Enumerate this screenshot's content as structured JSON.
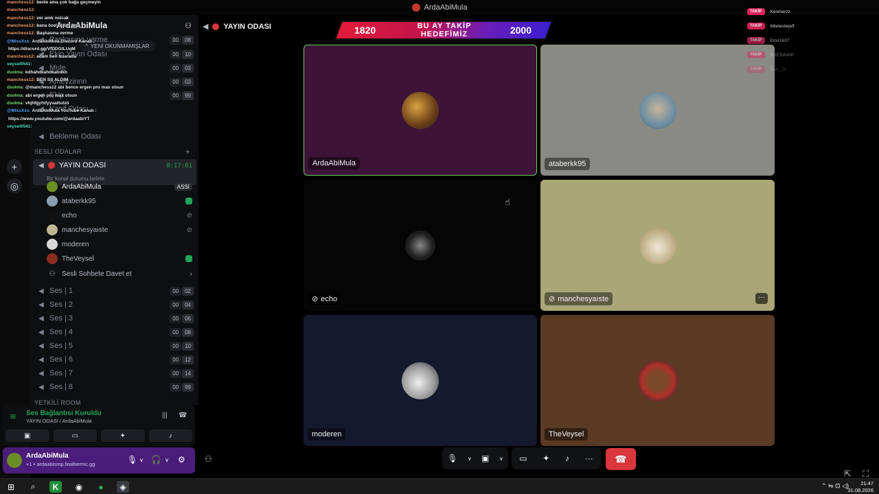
{
  "window": {
    "title": "ArdaAbiMula"
  },
  "server": {
    "name": "ArdaAbiMula",
    "unread_label": "YENİ OKUNMAMIŞLAR"
  },
  "sidebar": {
    "top_channels": [
      {
        "name": "Başkasına verme",
        "counts": [
          "00",
          "08"
        ]
      },
      {
        "name": "Ekip Yayın Odası",
        "counts": [
          "00",
          "10"
        ]
      },
      {
        "name": "Mule",
        "counts": [
          "00",
          "03"
        ]
      },
      {
        "name": "Ameyzinnn",
        "counts": [
          "00",
          "03"
        ]
      },
      {
        "name": "Ekip",
        "counts": [
          "00",
          "99"
        ]
      },
      {
        "name": "Kasif Odası",
        "counts": []
      },
      {
        "name": "Bekleme Odası",
        "counts": []
      }
    ],
    "category_1": "SESLİ ODALAR",
    "active_channel": {
      "name": "YAYIN ODASI",
      "timer": "8:17:01",
      "status_hint": "Bir kanal durumu belirle"
    },
    "voice_users": [
      {
        "name": "ArdaAbiMula",
        "badge": "ASSİ",
        "state": "none"
      },
      {
        "name": "ataberkk95",
        "badge": "",
        "state": "stream"
      },
      {
        "name": "echo",
        "badge": "",
        "state": "muted"
      },
      {
        "name": "manchesyaıste",
        "badge": "",
        "state": "muted"
      },
      {
        "name": "moderen",
        "badge": "",
        "state": "none"
      },
      {
        "name": "TheVeysel",
        "badge": "",
        "state": "stream"
      }
    ],
    "invite_label": "Sesli Sohbete Davet et",
    "ses_channels": [
      {
        "name": "Ses | 1",
        "counts": [
          "00",
          "02"
        ]
      },
      {
        "name": "Ses | 2",
        "counts": [
          "00",
          "04"
        ]
      },
      {
        "name": "Ses | 3",
        "counts": [
          "00",
          "06"
        ]
      },
      {
        "name": "Ses | 4",
        "counts": [
          "00",
          "08"
        ]
      },
      {
        "name": "Ses | 5",
        "counts": [
          "00",
          "10"
        ]
      },
      {
        "name": "Ses | 6",
        "counts": [
          "00",
          "12"
        ]
      },
      {
        "name": "Ses | 7",
        "counts": [
          "00",
          "14"
        ]
      },
      {
        "name": "Ses | 8",
        "counts": [
          "00",
          "99"
        ]
      }
    ],
    "category_2": "YETKİLİ ROOM"
  },
  "chat": [
    {
      "user": "manchess12:",
      "text": "benle ama çok bağa geçmeyin",
      "color": "#f0a070"
    },
    {
      "user": "manchess12:",
      "text": "",
      "color": "#f0a070"
    },
    {
      "user": "manchess12:",
      "text": "ver amk nolcak",
      "color": "#f0a070"
    },
    {
      "user": "manchess12:",
      "text": "bana özel olsun ama",
      "color": "#f0a070"
    },
    {
      "user": "manchess12:",
      "text": "Başkasına verme",
      "color": "#f0a070"
    },
    {
      "user": "@MissXss:",
      "text": "ArdaAbiMula Discord Kanalı :",
      "color": "#5aa9ff"
    },
    {
      "user": "",
      "text": "https://discord.gg/VfDDGtLUqM",
      "color": "#5aa9ff"
    },
    {
      "user": "manchess12:",
      "text": "adam ben buarada",
      "color": "#f0a070"
    },
    {
      "user": "veysel0541:",
      "text": "",
      "color": "#4fe3c1"
    },
    {
      "user": "dsolma:",
      "text": "kdhahdkahdkahdkh",
      "color": "#7fe07a"
    },
    {
      "user": "manchess12:",
      "text": "BEN SS ALDIM",
      "color": "#f0a070"
    },
    {
      "user": "dsolma:",
      "text": "@manchess12 abi bence ergen pro max olsun",
      "color": "#7fe07a"
    },
    {
      "user": "dsolma:",
      "text": "abi ergen pro max olsun",
      "color": "#7fe07a"
    },
    {
      "user": "dsolma:",
      "text": "vhjhfgyfxfyyuattutzö",
      "color": "#7fe07a"
    },
    {
      "user": "@MissXss:",
      "text": "ArdaAbiMula YouTube Kanalı :",
      "color": "#5aa9ff"
    },
    {
      "user": "",
      "text": "https://www.youtube.com/@ardaabiYT",
      "color": "#5aa9ff"
    },
    {
      "user": "veysel0541:",
      "text": "",
      "color": "#4fe3c1"
    }
  ],
  "voice_panel": {
    "status": "Ses Bağlantısı Kuruldu",
    "location": "YAYIN ODASI / ArdaAbiMula"
  },
  "user_panel": {
    "name": "ArdaAbiMula",
    "status": "+1 • ardaabismp.feathermc.gg"
  },
  "main": {
    "channel_title": "YAYIN ODASI"
  },
  "goal": {
    "current": "1820",
    "label_line1": "BU AY TAKİP",
    "label_line2": "HEDEFİMİZ",
    "target": "2000"
  },
  "follows": {
    "tag": "TAKİP",
    "names": [
      "Kenmerzz",
      "littlelestiejeff",
      "Emir1637",
      "SUCSAVAR",
      "ihsn_JX"
    ]
  },
  "tiles": [
    {
      "name": "ArdaAbiMula",
      "muted": false,
      "bg": "#3d1437"
    },
    {
      "name": "ataberkk95",
      "muted": false,
      "bg": "#8a8a85"
    },
    {
      "name": "echo",
      "muted": true,
      "bg": "#050505"
    },
    {
      "name": "manchesyaıste",
      "muted": true,
      "bg": "#a9a678"
    },
    {
      "name": "moderen",
      "muted": false,
      "bg": "#14192d"
    },
    {
      "name": "TheVeysel",
      "muted": false,
      "bg": "#5b3a24"
    }
  ],
  "taskbar": {
    "time": "21:47",
    "date": "31.08.2026"
  },
  "colors": {
    "accent_green": "#23a55a",
    "danger_red": "#da373c",
    "user_panel": "#4b1d7a"
  }
}
